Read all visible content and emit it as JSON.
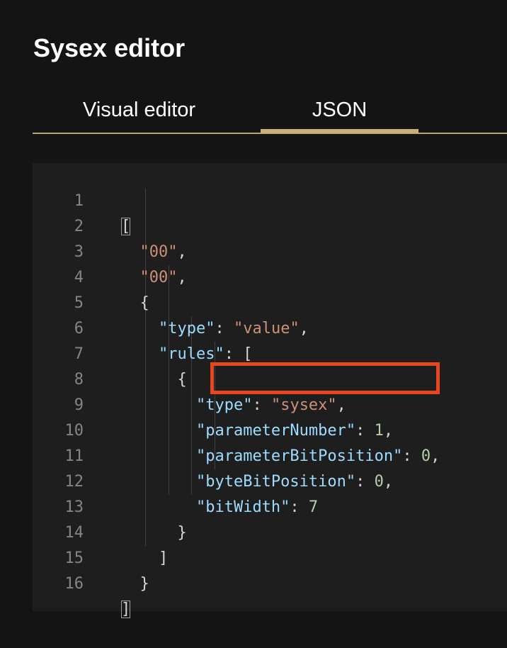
{
  "header": {
    "title": "Sysex editor"
  },
  "tabs": [
    {
      "label": "Visual editor",
      "active": false
    },
    {
      "label": "JSON",
      "active": true
    }
  ],
  "colors": {
    "accent": "#c9b27a",
    "highlight_box": "#e8461c",
    "key": "#9cdcfe",
    "string": "#ce9178",
    "number": "#b5cea8"
  },
  "editor": {
    "lines": [
      {
        "n": "1"
      },
      {
        "n": "2",
        "s": "\"00\""
      },
      {
        "n": "3",
        "s": "\"00\""
      },
      {
        "n": "4"
      },
      {
        "n": "5",
        "k": "\"type\"",
        "s": "\"value\""
      },
      {
        "n": "6",
        "k": "\"rules\""
      },
      {
        "n": "7"
      },
      {
        "n": "8",
        "k": "\"type\"",
        "s": "\"sysex\""
      },
      {
        "n": "9",
        "k": "\"parameterNumber\"",
        "v": "1"
      },
      {
        "n": "10",
        "k": "\"parameterBitPosition\"",
        "v": "0"
      },
      {
        "n": "11",
        "k": "\"byteBitPosition\"",
        "v": "0"
      },
      {
        "n": "12",
        "k": "\"bitWidth\"",
        "v": "7"
      },
      {
        "n": "13"
      },
      {
        "n": "14"
      },
      {
        "n": "15"
      },
      {
        "n": "16"
      }
    ],
    "highlighted_line": "9"
  }
}
